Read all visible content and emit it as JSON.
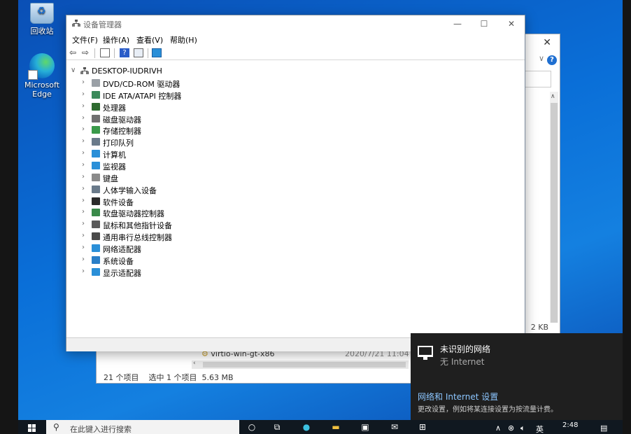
{
  "desktop": {
    "icons": [
      {
        "label": "回收站"
      },
      {
        "label": "Microsoft Edge"
      }
    ]
  },
  "device_manager": {
    "title": "设备管理器",
    "menu": [
      "文件(F)",
      "操作(A)",
      "查看(V)",
      "帮助(H)"
    ],
    "root": "DESKTOP-IUDRIVH",
    "categories": [
      {
        "label": "DVD/CD-ROM 驱动器",
        "icon": "dvd-drive-icon",
        "color": "#9aa0a6"
      },
      {
        "label": "IDE ATA/ATAPI 控制器",
        "icon": "ide-controller-icon",
        "color": "#3a8a5a"
      },
      {
        "label": "处理器",
        "icon": "processor-icon",
        "color": "#2e6b30"
      },
      {
        "label": "磁盘驱动器",
        "icon": "disk-drive-icon",
        "color": "#707070"
      },
      {
        "label": "存储控制器",
        "icon": "storage-controller-icon",
        "color": "#3a9a4a"
      },
      {
        "label": "打印队列",
        "icon": "printer-icon",
        "color": "#6a7a8a"
      },
      {
        "label": "计算机",
        "icon": "computer-icon",
        "color": "#2a8fd8"
      },
      {
        "label": "监视器",
        "icon": "monitor-icon",
        "color": "#2a8fd8"
      },
      {
        "label": "键盘",
        "icon": "keyboard-icon",
        "color": "#8a8a8a"
      },
      {
        "label": "人体学输入设备",
        "icon": "hid-icon",
        "color": "#6a7a8a"
      },
      {
        "label": "软件设备",
        "icon": "software-device-icon",
        "color": "#2a2a2a"
      },
      {
        "label": "软盘驱动器控制器",
        "icon": "floppy-controller-icon",
        "color": "#3a8a4a"
      },
      {
        "label": "鼠标和其他指针设备",
        "icon": "mouse-icon",
        "color": "#5a5a5a"
      },
      {
        "label": "通用串行总线控制器",
        "icon": "usb-icon",
        "color": "#4a4a4a"
      },
      {
        "label": "网络适配器",
        "icon": "network-adapter-icon",
        "color": "#2a8fd8"
      },
      {
        "label": "系统设备",
        "icon": "system-device-icon",
        "color": "#2a7fc8"
      },
      {
        "label": "显示适配器",
        "icon": "display-adapter-icon",
        "color": "#2a8fd8"
      }
    ]
  },
  "explorer": {
    "file_name": "virtio-win-gt-x86",
    "file_date": "2020/7/21 11:04",
    "size_cell": "2 KB",
    "status": "21 个项目    选中 1 个项目  5.63 MB"
  },
  "network_flyout": {
    "network_name": "未识别的网络",
    "network_status": "无 Internet",
    "settings_link": "网络和 Internet 设置",
    "settings_desc": "更改设置，例如将某连接设置为按流量计费。"
  },
  "taskbar": {
    "search_placeholder": "在此键入进行搜索",
    "time": "2:48",
    "ime": "英"
  }
}
